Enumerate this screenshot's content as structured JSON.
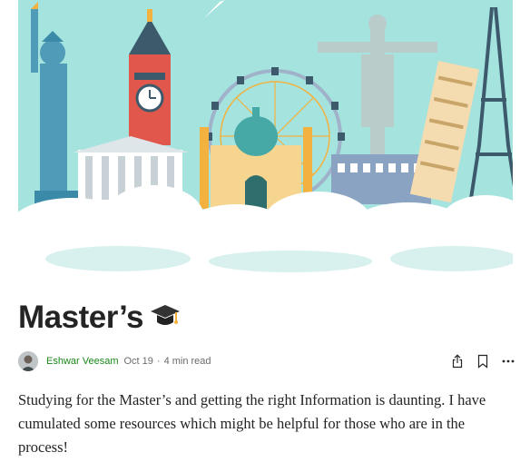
{
  "hero": {
    "image": "travel-landmarks-illustration",
    "colors": {
      "sky": "#a5e3df",
      "clouds": "#ffffff"
    }
  },
  "article": {
    "title": "Master’s",
    "title_emoji": "graduation-cap-icon",
    "author": "Eshwar Veesam",
    "date": "Oct 19",
    "separator": "·",
    "read_time": "4 min read",
    "body": "Studying for the Master’s and getting the right Information is daunting. I have cumulated some resources which might be helpful for those who are in the process!"
  },
  "actions": {
    "share": "share-icon",
    "bookmark": "bookmark-icon",
    "more": "more-icon"
  },
  "colors": {
    "author_link": "#1a8917",
    "text": "#242424",
    "muted": "#6b6b6b"
  }
}
